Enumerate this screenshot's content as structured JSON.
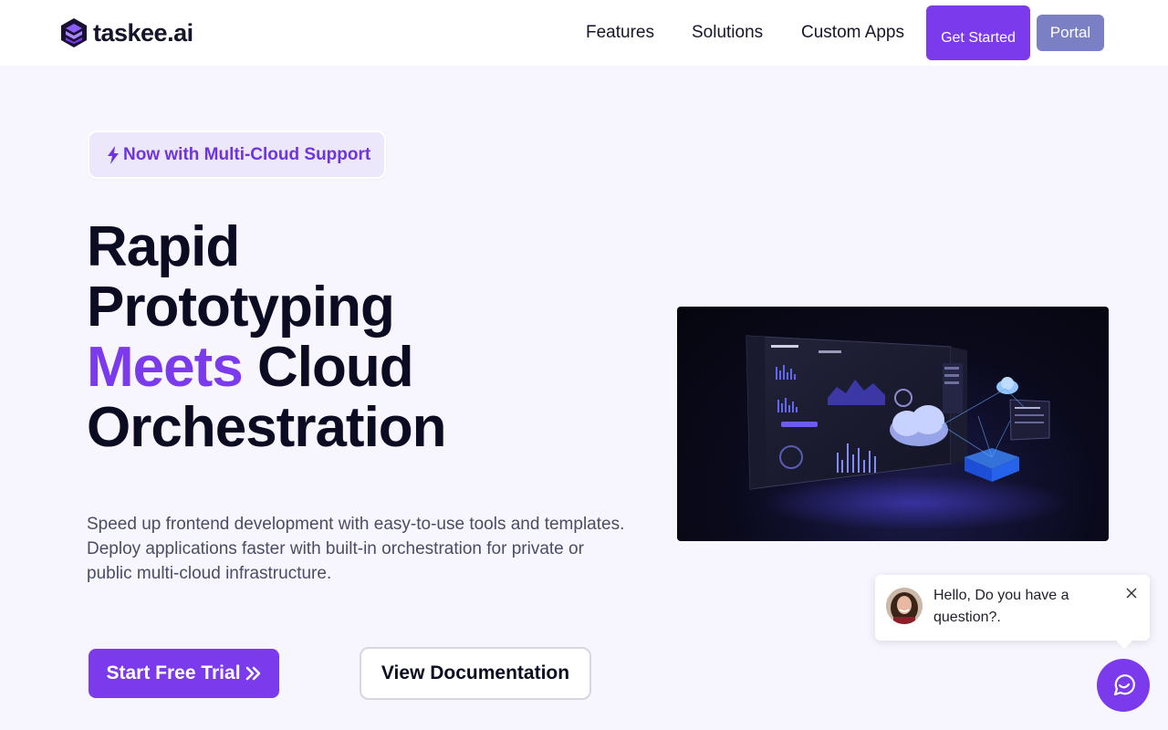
{
  "header": {
    "logo_text": "taskee.ai",
    "nav": [
      "Features",
      "Solutions",
      "Custom Apps"
    ],
    "get_started_label": "Get Started",
    "portal_label": "Portal"
  },
  "hero": {
    "badge_icon": "bolt-icon",
    "badge_text": "Now with Multi-Cloud Support",
    "headline_line1": "Rapid",
    "headline_line2": "Prototyping",
    "headline_accent": "Meets",
    "headline_line3_rest": " Cloud",
    "headline_line4": "Orchestration",
    "description_line1": "Speed up frontend development with easy-to-use tools and templates.",
    "description_line2": "Deploy applications faster with built-in orchestration for private or public multi-cloud infrastructure.",
    "trial_label": "Start Free Trial",
    "docs_label": "View Documentation"
  },
  "chat": {
    "message": "Hello, Do you have a question?."
  },
  "colors": {
    "accent": "#7c3aed",
    "portal": "#7b7fc4",
    "background": "#f7f5fd",
    "heading": "#0b0b22"
  }
}
